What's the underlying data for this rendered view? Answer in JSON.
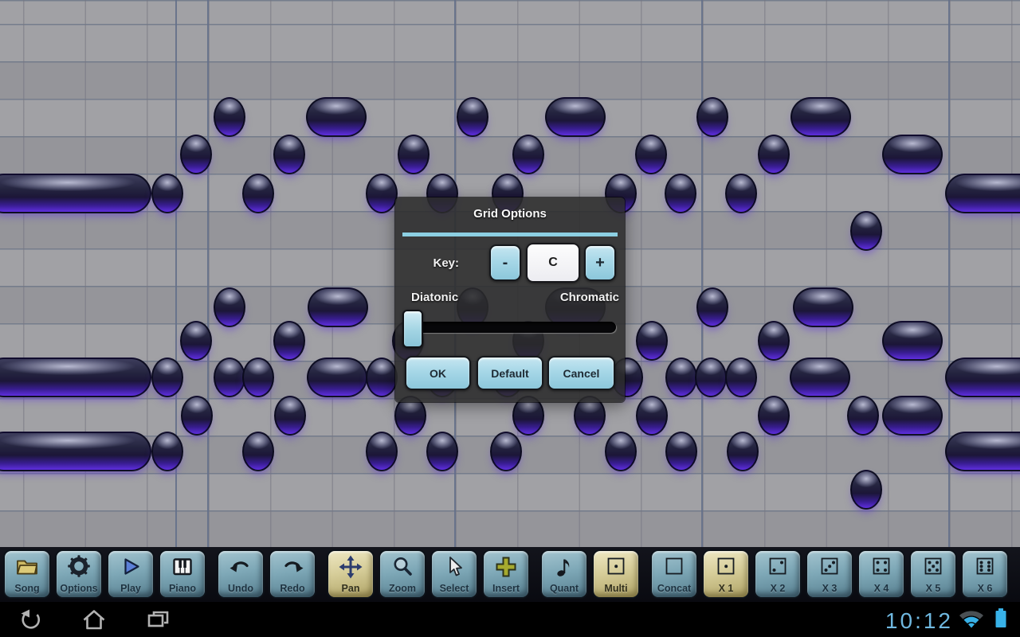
{
  "dialog": {
    "title": "Grid Options",
    "accent_color": "#8ccfe2",
    "key_label": "Key:",
    "minus_label": "-",
    "key_value": "C",
    "plus_label": "+",
    "scale_left_label": "Diatonic",
    "scale_right_label": "Chromatic",
    "slider": {
      "selected": "Diatonic",
      "thumb_position": "left"
    },
    "ok_label": "OK",
    "default_label": "Default",
    "cancel_label": "Cancel"
  },
  "toolbar": {
    "active_color": "#d6cd99",
    "button_color": "#7ea8b7",
    "buttons": [
      {
        "label": "Song",
        "icon": "folder",
        "active": false,
        "gap_before": false
      },
      {
        "label": "Options",
        "icon": "gear",
        "active": false,
        "gap_before": false
      },
      {
        "label": "Play",
        "icon": "play",
        "active": false,
        "gap_before": false
      },
      {
        "label": "Piano",
        "icon": "piano",
        "active": false,
        "gap_before": false
      },
      {
        "label": "Undo",
        "icon": "undo",
        "active": false,
        "gap_before": true
      },
      {
        "label": "Redo",
        "icon": "redo",
        "active": false,
        "gap_before": false
      },
      {
        "label": "Pan",
        "icon": "pan",
        "active": true,
        "gap_before": true
      },
      {
        "label": "Zoom",
        "icon": "magnifier",
        "active": false,
        "gap_before": false
      },
      {
        "label": "Select",
        "icon": "cursor",
        "active": false,
        "gap_before": false
      },
      {
        "label": "Insert",
        "icon": "plus",
        "active": false,
        "gap_before": false
      },
      {
        "label": "Quant",
        "icon": "eighth-note",
        "active": false,
        "gap_before": true
      },
      {
        "label": "Multi",
        "icon": "square-dot",
        "active": true,
        "gap_before": false
      },
      {
        "label": "Concat",
        "icon": "square",
        "active": false,
        "gap_before": true
      },
      {
        "label": "X 1",
        "icon": "dice-1",
        "active": true,
        "gap_before": false
      },
      {
        "label": "X 2",
        "icon": "dice-2",
        "active": false,
        "gap_before": false
      },
      {
        "label": "X 3",
        "icon": "dice-3",
        "active": false,
        "gap_before": false
      },
      {
        "label": "X 4",
        "icon": "dice-4",
        "active": false,
        "gap_before": false
      },
      {
        "label": "X 5",
        "icon": "dice-5",
        "active": false,
        "gap_before": false
      },
      {
        "label": "X 6",
        "icon": "dice-6",
        "active": false,
        "gap_before": false
      }
    ]
  },
  "piano_roll": {
    "note_color": "#5e2ede",
    "note_shapes": {
      "r": "round-note",
      "p": "pill-note",
      "ll": "long-note-left-edge",
      "lr": "long-note-right-edge"
    },
    "notes": [
      [
        "r",
        288,
        147
      ],
      [
        "p",
        422,
        147
      ],
      [
        "r",
        593,
        147
      ],
      [
        "p",
        722,
        147
      ],
      [
        "r",
        894,
        147
      ],
      [
        "p",
        1030,
        147
      ],
      [
        "r",
        246,
        194
      ],
      [
        "r",
        363,
        194
      ],
      [
        "r",
        519,
        194
      ],
      [
        "r",
        663,
        194
      ],
      [
        "r",
        817,
        194
      ],
      [
        "r",
        971,
        194
      ],
      [
        "p",
        1145,
        194
      ],
      [
        "ll",
        85,
        243
      ],
      [
        "r",
        210,
        243
      ],
      [
        "r",
        324,
        243
      ],
      [
        "r",
        479,
        243
      ],
      [
        "r",
        555,
        243
      ],
      [
        "r",
        637,
        243
      ],
      [
        "r",
        779,
        243
      ],
      [
        "r",
        854,
        243
      ],
      [
        "r",
        930,
        243
      ],
      [
        "lr",
        1251,
        243
      ],
      [
        "r",
        1087,
        290
      ],
      [
        "r",
        288,
        386
      ],
      [
        "p",
        424,
        386
      ],
      [
        "r",
        593,
        386
      ],
      [
        "p",
        722,
        386
      ],
      [
        "r",
        894,
        386
      ],
      [
        "p",
        1033,
        386
      ],
      [
        "r",
        246,
        428
      ],
      [
        "r",
        363,
        428
      ],
      [
        "r",
        512,
        428
      ],
      [
        "r",
        663,
        428
      ],
      [
        "r",
        818,
        428
      ],
      [
        "r",
        971,
        428
      ],
      [
        "p",
        1145,
        428
      ],
      [
        "ll",
        85,
        474
      ],
      [
        "r",
        210,
        474
      ],
      [
        "r",
        288,
        474
      ],
      [
        "r",
        324,
        474
      ],
      [
        "p",
        423,
        474
      ],
      [
        "r",
        479,
        474
      ],
      [
        "r",
        555,
        474
      ],
      [
        "r",
        637,
        474
      ],
      [
        "r",
        787,
        474
      ],
      [
        "r",
        855,
        474
      ],
      [
        "r",
        892,
        474
      ],
      [
        "r",
        930,
        474
      ],
      [
        "p",
        1029,
        474
      ],
      [
        "lr",
        1251,
        474
      ],
      [
        "r",
        247,
        522
      ],
      [
        "r",
        364,
        522
      ],
      [
        "r",
        515,
        522
      ],
      [
        "r",
        663,
        522
      ],
      [
        "r",
        740,
        522
      ],
      [
        "r",
        818,
        522
      ],
      [
        "r",
        971,
        522
      ],
      [
        "r",
        1083,
        522
      ],
      [
        "p",
        1145,
        522
      ],
      [
        "ll",
        85,
        567
      ],
      [
        "r",
        210,
        567
      ],
      [
        "r",
        324,
        567
      ],
      [
        "r",
        479,
        567
      ],
      [
        "r",
        555,
        567
      ],
      [
        "r",
        635,
        567
      ],
      [
        "r",
        779,
        567
      ],
      [
        "r",
        855,
        567
      ],
      [
        "r",
        932,
        567
      ],
      [
        "lr",
        1251,
        567
      ],
      [
        "r",
        1087,
        615
      ]
    ]
  },
  "system_bar": {
    "clock": "10:12",
    "clock_color": "#6fb8e0",
    "nav_icons": [
      "back",
      "home",
      "recents"
    ],
    "status_icons": [
      "wifi",
      "battery"
    ]
  }
}
